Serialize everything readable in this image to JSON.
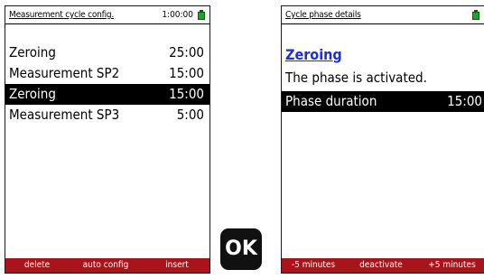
{
  "left_screen": {
    "title": "Measurement cycle config.",
    "clock": "1:00:00",
    "battery_color": "#1fa32a",
    "rows": [
      {
        "label": "Zeroing",
        "value": "25:00",
        "selected": false
      },
      {
        "label": "Measurement SP2",
        "value": "15:00",
        "selected": false
      },
      {
        "label": "Zeroing",
        "value": "15:00",
        "selected": true
      },
      {
        "label": "Measurement SP3",
        "value": "5:00",
        "selected": false
      }
    ],
    "softkeys": [
      "delete",
      "auto config",
      "insert"
    ]
  },
  "ok_button": {
    "label": "OK"
  },
  "right_screen": {
    "title": "Cycle phase details",
    "battery_color": "#1fa32a",
    "heading": "Zeroing",
    "status": "The phase is activated.",
    "detail_row": {
      "label": "Phase duration",
      "value": "15:00"
    },
    "softkeys": [
      "-5 minutes",
      "deactivate",
      "+5 minutes"
    ]
  },
  "colors": {
    "softkey_bar": "#a8141a",
    "heading": "#1c2fd4",
    "selection": "#000000"
  }
}
